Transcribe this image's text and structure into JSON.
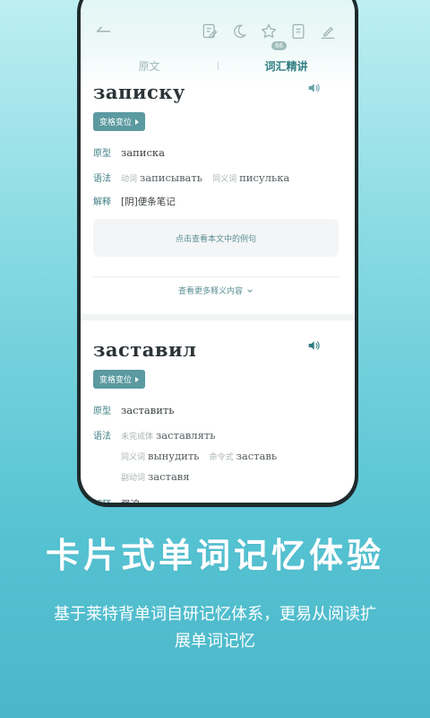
{
  "toolbar": {
    "icons": [
      "back-arrow-icon",
      "edit-note-icon",
      "moon-icon",
      "star-icon",
      "document-icon",
      "pen-icon"
    ]
  },
  "tabs": [
    {
      "label": "原文",
      "active": false
    },
    {
      "label": "词汇精讲",
      "active": true
    }
  ],
  "tab_badge": "66",
  "cards": [
    {
      "word": "записку",
      "inflect_label": "变格变位",
      "lemma_label": "原型",
      "lemma": "записка",
      "grammar_label": "语法",
      "grammar": [
        {
          "tag": "动词",
          "word": "записывать"
        },
        {
          "tag": "同义词",
          "word": "писулька"
        }
      ],
      "meaning_label": "解释",
      "meaning": "[阴]便条笔记",
      "example_button": "点击查看本文中的例句",
      "more_label": "查看更多释义内容"
    },
    {
      "word": "заставил",
      "inflect_label": "变格变位",
      "lemma_label": "原型",
      "lemma": "заставить",
      "grammar_label": "语法",
      "grammar_lines": [
        [
          {
            "tag": "未完成体",
            "word": "заставлять"
          }
        ],
        [
          {
            "tag": "同义词",
            "word": "вынудить"
          },
          {
            "tag": "命令式",
            "word": "заставь"
          }
        ],
        [
          {
            "tag": "副动词",
            "word": "заставя"
          }
        ]
      ],
      "meaning_label": "解释",
      "meaning": "强迫"
    }
  ],
  "caption": "卡片式单词记忆体验",
  "subcaption": "基于莱特背单词自研记忆体系，更易从阅读扩展单词记忆",
  "colors": {
    "accent": "#2f7e82",
    "button": "#5b9aa0",
    "background_top": "#bdeef2",
    "background_bottom": "#4bb6c8"
  }
}
